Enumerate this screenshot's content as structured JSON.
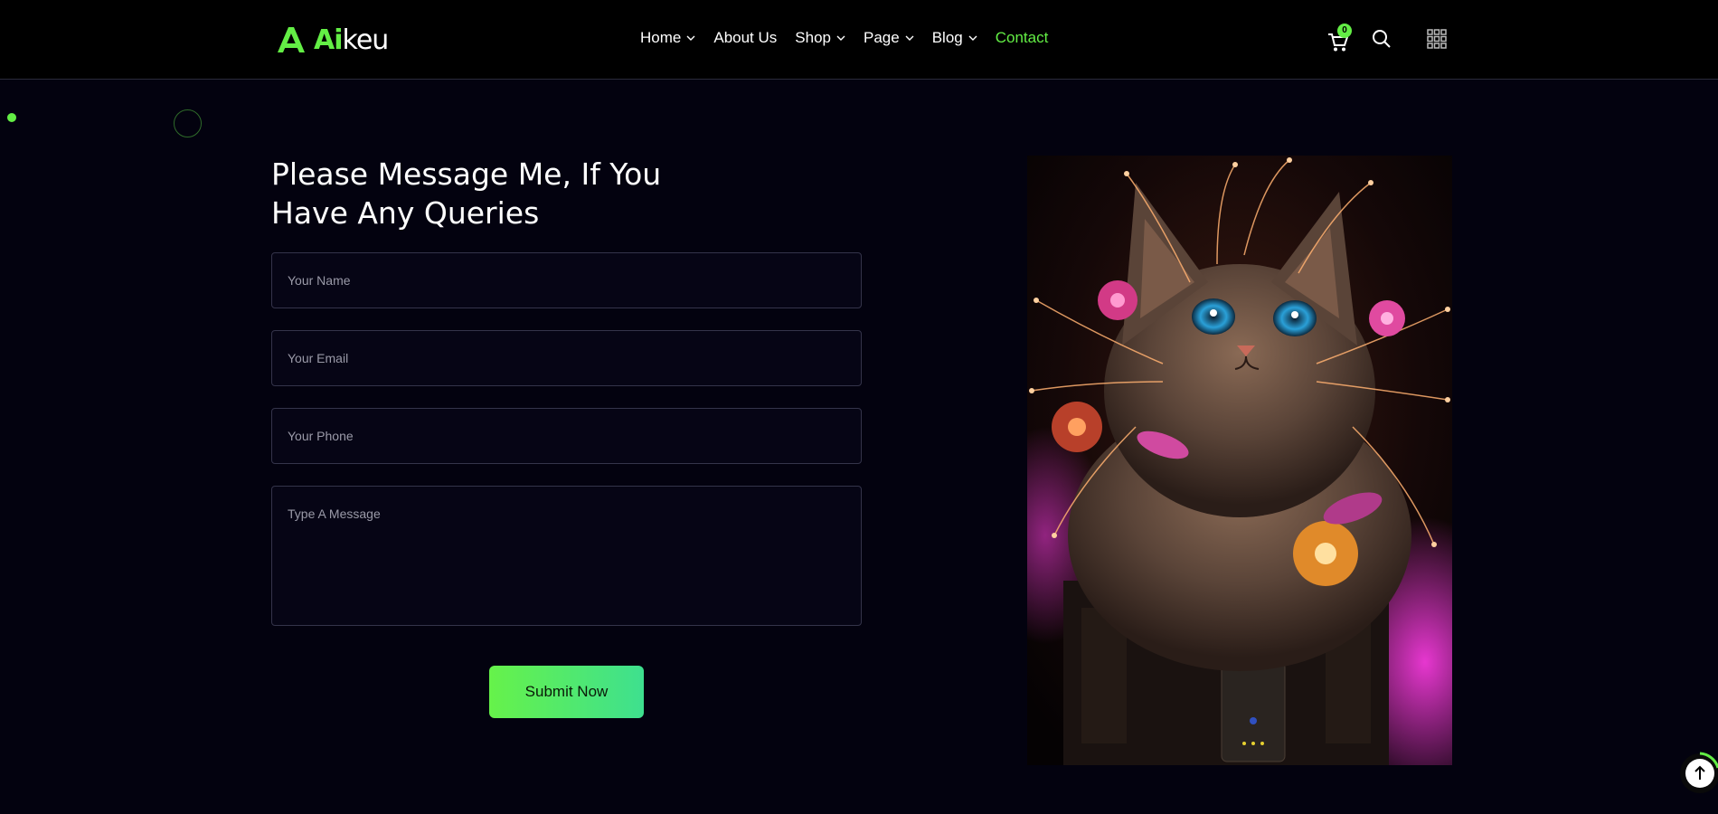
{
  "brand": {
    "name_accent": "Ai",
    "name_rest": "keu",
    "color": "#63ee45"
  },
  "nav": {
    "items": [
      {
        "label": "Home",
        "has_dropdown": true
      },
      {
        "label": "About Us",
        "has_dropdown": false
      },
      {
        "label": "Shop",
        "has_dropdown": true
      },
      {
        "label": "Page",
        "has_dropdown": true
      },
      {
        "label": "Blog",
        "has_dropdown": true
      },
      {
        "label": "Contact",
        "has_dropdown": false,
        "active": true
      }
    ]
  },
  "header_actions": {
    "cart_count": "0",
    "cart_icon": "cart-icon",
    "search_icon": "search-icon",
    "menu_icon": "grid-menu-icon"
  },
  "contact": {
    "title_line1": "Please Message Me, If You",
    "title_line2": "Have Any Queries",
    "name_placeholder": "Your Name",
    "email_placeholder": "Your Email",
    "phone_placeholder": "Your Phone",
    "message_placeholder": "Type A Message",
    "submit_label": "Submit Now"
  },
  "image": {
    "alt": "cyberpunk cat with glowing fibers and flowers"
  },
  "scroll_top": {
    "icon": "arrow-up-icon"
  }
}
